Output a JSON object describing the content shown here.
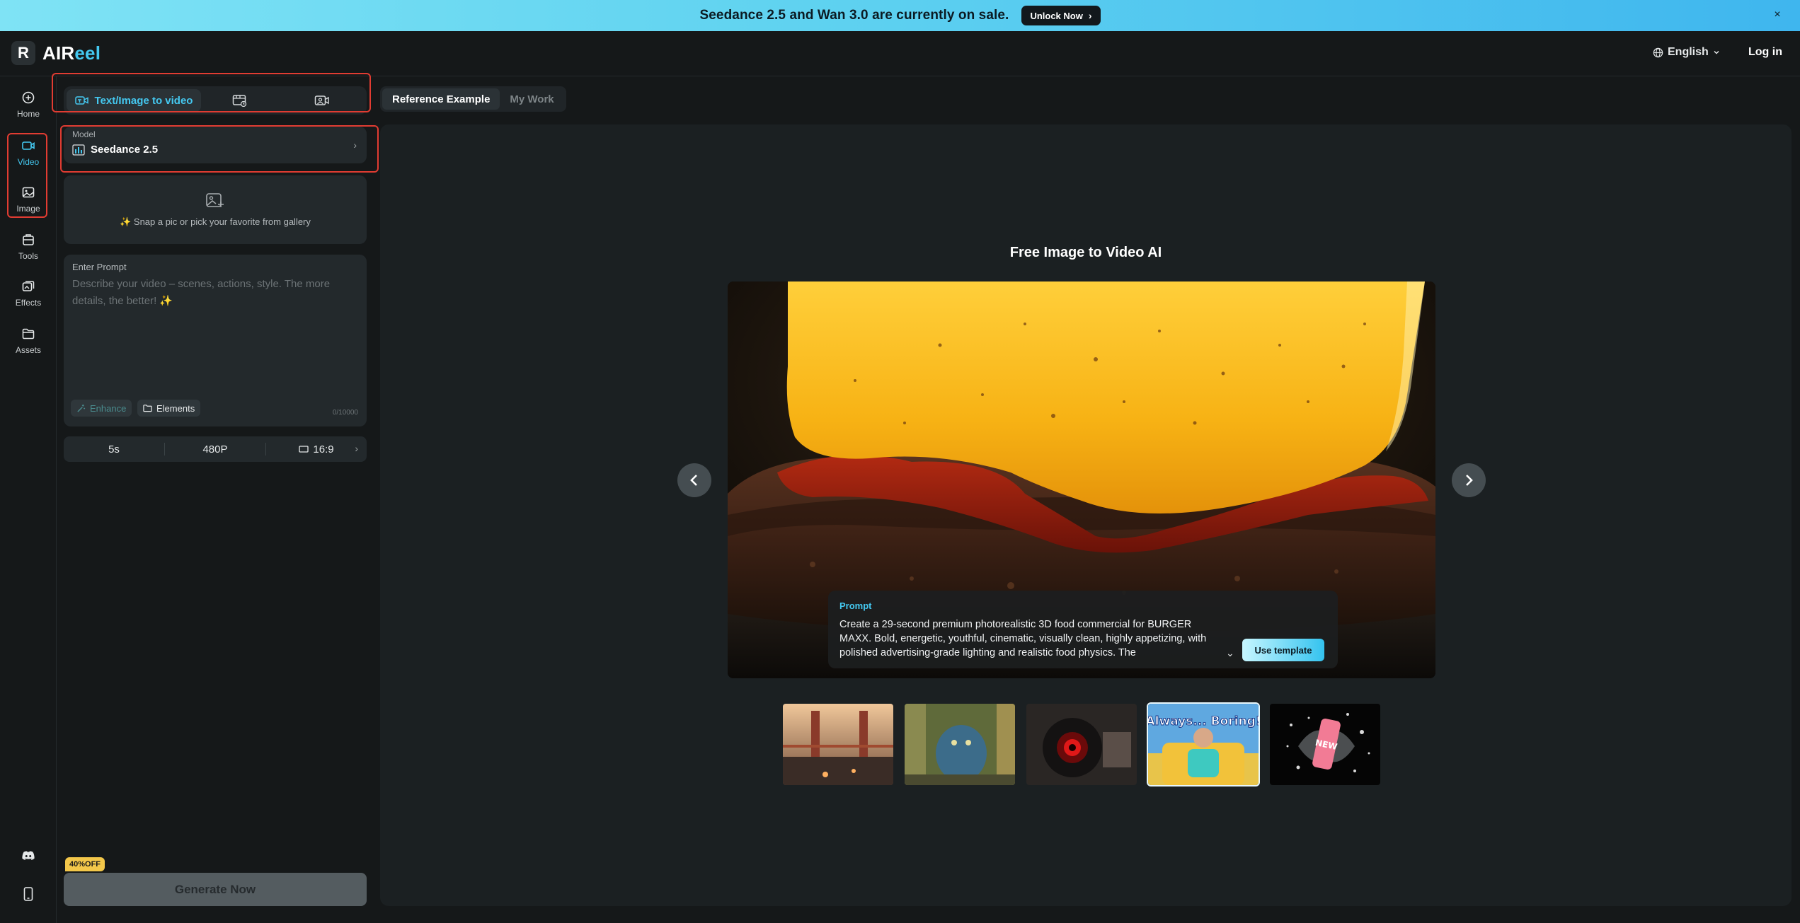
{
  "banner": {
    "text": "Seedance 2.5 and Wan 3.0 are currently on sale.",
    "cta": "Unlock Now",
    "close": "×"
  },
  "header": {
    "logo_mark": "R",
    "brand_main": "AIR",
    "brand_accent": "eel",
    "language": "English",
    "login": "Log in"
  },
  "rail": {
    "items": [
      {
        "label": "Home",
        "icon": "home-icon"
      },
      {
        "label": "Video",
        "icon": "video-icon",
        "active": true
      },
      {
        "label": "Image",
        "icon": "image-icon"
      },
      {
        "label": "Tools",
        "icon": "tools-icon"
      },
      {
        "label": "Effects",
        "icon": "effects-icon"
      },
      {
        "label": "Assets",
        "icon": "folder-icon"
      }
    ],
    "bottom": [
      "discord-icon",
      "mobile-icon"
    ]
  },
  "panel": {
    "tabs": {
      "active_label": "Text/Image to video",
      "icons": [
        "text-image-video-icon",
        "frames-video-icon",
        "reference-video-icon"
      ]
    },
    "model": {
      "label": "Model",
      "value": "Seedance 2.5"
    },
    "upload": {
      "text": "✨ Snap a pic or pick your favorite from gallery"
    },
    "prompt": {
      "label": "Enter Prompt",
      "placeholder": "Describe your video – scenes, actions, style. The more details, the better! ✨",
      "enhance": "Enhance",
      "elements": "Elements",
      "count": "0/10000"
    },
    "settings": {
      "duration": "5s",
      "resolution": "480P",
      "ratio": "16:9"
    },
    "discount": "40%OFF",
    "generate": "Generate Now"
  },
  "content": {
    "tabs": [
      "Reference Example",
      "My Work"
    ],
    "title": "Free Image to Video AI",
    "prompt_label": "Prompt",
    "prompt_text": "Create a 29-second premium photorealistic 3D food commercial for BURGER MAXX. Bold, energetic, youthful, cinematic, visually clean, highly appetizing, with polished advertising-grade lighting and realistic food physics. The",
    "use_template": "Use template",
    "thumb_4_text": "Always... Boring!",
    "thumb_5_text": "NEW"
  },
  "colors": {
    "accent": "#44c8f0",
    "highlight": "#e13c32",
    "badge": "#f3c74a"
  }
}
